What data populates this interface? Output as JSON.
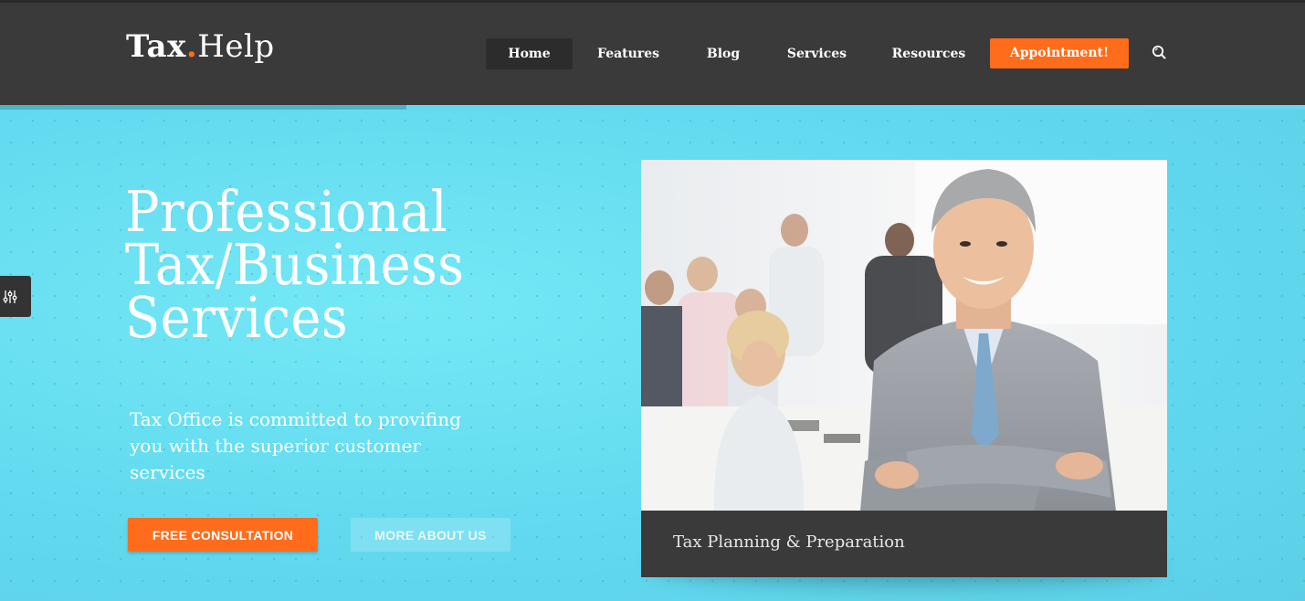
{
  "brand": {
    "name_bold": "Tax",
    "dot": ".",
    "name_light": "Help"
  },
  "nav": {
    "items": [
      {
        "label": "Home",
        "active": true
      },
      {
        "label": "Features"
      },
      {
        "label": "Blog"
      },
      {
        "label": "Services"
      },
      {
        "label": "Resources"
      }
    ],
    "cta_label": "Appointment!"
  },
  "hero": {
    "title_lines": [
      "Professional",
      "Tax/Business",
      "Services"
    ],
    "subtitle": "Tax Office is committed to provifing you with the superior customer services",
    "primary_button": "FREE CONSULTATION",
    "secondary_button": "MORE ABOUT US"
  },
  "card": {
    "caption": "Tax Planning & Preparation"
  },
  "icons": {
    "search": "search-icon",
    "settings": "sliders-icon"
  },
  "colors": {
    "accent": "#ff6c1c",
    "header_bg": "#3a3a3a",
    "hero_bg": "#62d9ef",
    "caption_bg": "#3a3a3a"
  }
}
